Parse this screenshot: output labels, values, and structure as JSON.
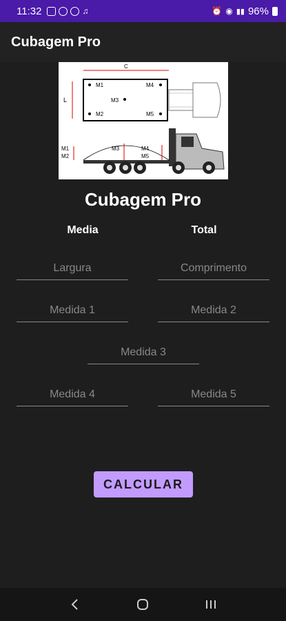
{
  "status_bar": {
    "time": "11:32",
    "battery": "96%"
  },
  "app_bar": {
    "title": "Cubagem Pro"
  },
  "diagram": {
    "label_c": "C",
    "label_l": "L",
    "labels_top": [
      "M1",
      "M4",
      "M3",
      "M2",
      "M5"
    ],
    "labels_side": [
      "M1",
      "M2",
      "M3",
      "M4",
      "M5"
    ]
  },
  "main": {
    "title": "Cubagem Pro",
    "result_media": "Media",
    "result_total": "Total"
  },
  "form": {
    "largura_placeholder": "Largura",
    "comprimento_placeholder": "Comprimento",
    "medida1_placeholder": "Medida 1",
    "medida2_placeholder": "Medida 2",
    "medida3_placeholder": "Medida 3",
    "medida4_placeholder": "Medida 4",
    "medida5_placeholder": "Medida 5"
  },
  "actions": {
    "calculate_label": "CALCULAR"
  },
  "colors": {
    "status_bar": "#4a1aa8",
    "button": "#c39bff",
    "background": "#1e1e1e"
  }
}
